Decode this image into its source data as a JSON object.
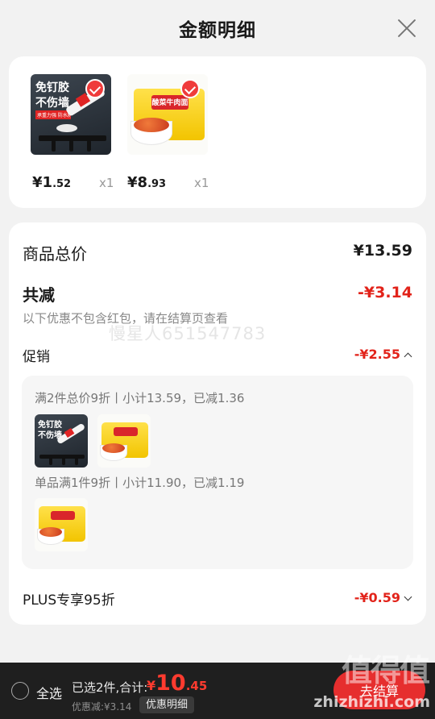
{
  "header": {
    "title": "金额明细"
  },
  "products": [
    {
      "name_line1": "免钉胶",
      "name_line2": "不伤墙",
      "sub": "承重力强 防水防潮",
      "price_int": "¥1",
      "price_dec": ".52",
      "qty": "x1"
    },
    {
      "name": "酸菜牛肉面",
      "price_int": "¥8",
      "price_dec": ".93",
      "qty": "x1"
    }
  ],
  "summary": {
    "goods_total_label": "商品总价",
    "goods_total_value": "¥13.59",
    "reduction_label": "共减",
    "reduction_value": "-¥3.14",
    "reduction_note": "以下优惠不包含红包，请在结算页查看",
    "promo_label": "促销",
    "promo_value": "-¥2.55",
    "promo_items": [
      "满2件总价9折丨小计13.59，已减1.36",
      "单品满1件9折丨小计11.90，已减1.19"
    ],
    "plus_label": "PLUS专享95折",
    "plus_value": "-¥0.59"
  },
  "watermark": "慢星人651547783",
  "site": {
    "mark": "值得值",
    "url": "zhizhizhi.com"
  },
  "bottom": {
    "select_all": "全选",
    "selected_info": "已选2件,合计:",
    "total_currency": "¥",
    "total_int": "10",
    "total_dec": ".45",
    "discount_info": "优惠减:¥3.14",
    "detail_button": "优惠明细",
    "checkout_button": "去结算"
  },
  "colors": {
    "accent": "#e2231a",
    "checkout": "#e62e2e",
    "bottom_bar": "#1f1f1f"
  }
}
